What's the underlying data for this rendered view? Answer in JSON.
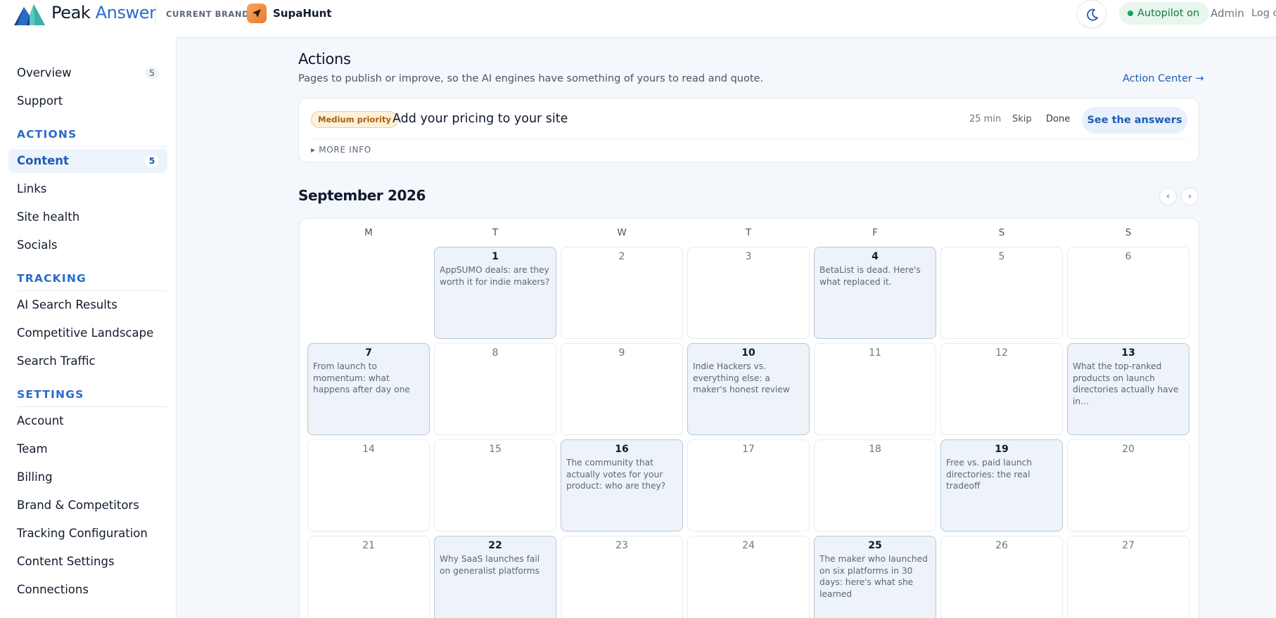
{
  "header": {
    "logo_part1": "Peak",
    "logo_part2": "Answer",
    "brand_label": "CURRENT BRAND",
    "brand_name": "SupaHunt",
    "autopilot_label": "Autopilot on",
    "admin_label": "Admin",
    "logout_label": "Log out"
  },
  "sidebar": {
    "top": [
      {
        "label": "Overview",
        "badge": "5"
      },
      {
        "label": "Support"
      }
    ],
    "sections": [
      {
        "title": "ACTIONS",
        "items": [
          {
            "label": "Content",
            "badge": "5",
            "active": true
          },
          {
            "label": "Links"
          },
          {
            "label": "Site health"
          },
          {
            "label": "Socials"
          }
        ]
      },
      {
        "title": "TRACKING",
        "items": [
          {
            "label": "AI Search Results"
          },
          {
            "label": "Competitive Landscape"
          },
          {
            "label": "Search Traffic"
          }
        ]
      },
      {
        "title": "SETTINGS",
        "items": [
          {
            "label": "Account"
          },
          {
            "label": "Team"
          },
          {
            "label": "Billing"
          },
          {
            "label": "Brand & Competitors"
          },
          {
            "label": "Tracking Configuration"
          },
          {
            "label": "Content Settings"
          },
          {
            "label": "Connections"
          }
        ]
      }
    ]
  },
  "actions": {
    "title": "Actions",
    "subtitle": "Pages to publish or improve, so the AI engines have something of yours to read and quote.",
    "action_center_link": "Action Center →",
    "task": {
      "priority": "Medium priority",
      "title": "Add your pricing to your site",
      "time": "25 min",
      "skip_label": "Skip",
      "done_label": "Done",
      "cta_label": "See the answers",
      "more_info_label": "▸  MORE INFO"
    }
  },
  "calendar": {
    "month_title": "September 2026",
    "prev_label": "‹",
    "next_label": "›",
    "weekdays": [
      "M",
      "T",
      "W",
      "T",
      "F",
      "S",
      "S"
    ],
    "weeks": [
      [
        null,
        {
          "day": "1",
          "event": "AppSUMO deals: are they worth it for indie makers?"
        },
        {
          "day": "2"
        },
        {
          "day": "3"
        },
        {
          "day": "4",
          "event": "BetaList is dead. Here's what replaced it."
        },
        {
          "day": "5"
        },
        {
          "day": "6"
        }
      ],
      [
        {
          "day": "7",
          "event": "From launch to momentum: what happens after day one"
        },
        {
          "day": "8"
        },
        {
          "day": "9"
        },
        {
          "day": "10",
          "event": "Indie Hackers vs. everything else: a maker's honest review"
        },
        {
          "day": "11"
        },
        {
          "day": "12"
        },
        {
          "day": "13",
          "event": "What the top-ranked products on launch directories actually have in…"
        }
      ],
      [
        {
          "day": "14"
        },
        {
          "day": "15"
        },
        {
          "day": "16",
          "event": "The community that actually votes for your product: who are they?"
        },
        {
          "day": "17"
        },
        {
          "day": "18"
        },
        {
          "day": "19",
          "event": "Free vs. paid launch directories: the real tradeoff"
        },
        {
          "day": "20"
        }
      ],
      [
        {
          "day": "21"
        },
        {
          "day": "22",
          "event": "Why SaaS launches fail on generalist platforms"
        },
        {
          "day": "23"
        },
        {
          "day": "24"
        },
        {
          "day": "25",
          "event": "The maker who launched on six platforms in 30 days: here's what she learned"
        },
        {
          "day": "26"
        },
        {
          "day": "27"
        }
      ]
    ]
  },
  "colors": {
    "accent": "#2a6bc9",
    "autopilot_green": "#19a35a",
    "priority_amber": "#a76208",
    "event_cell_bg": "#edf3f9"
  },
  "icons": [
    "peak-answer-logo-icon",
    "paper-plane-icon",
    "moon-icon",
    "status-dot-icon"
  ]
}
